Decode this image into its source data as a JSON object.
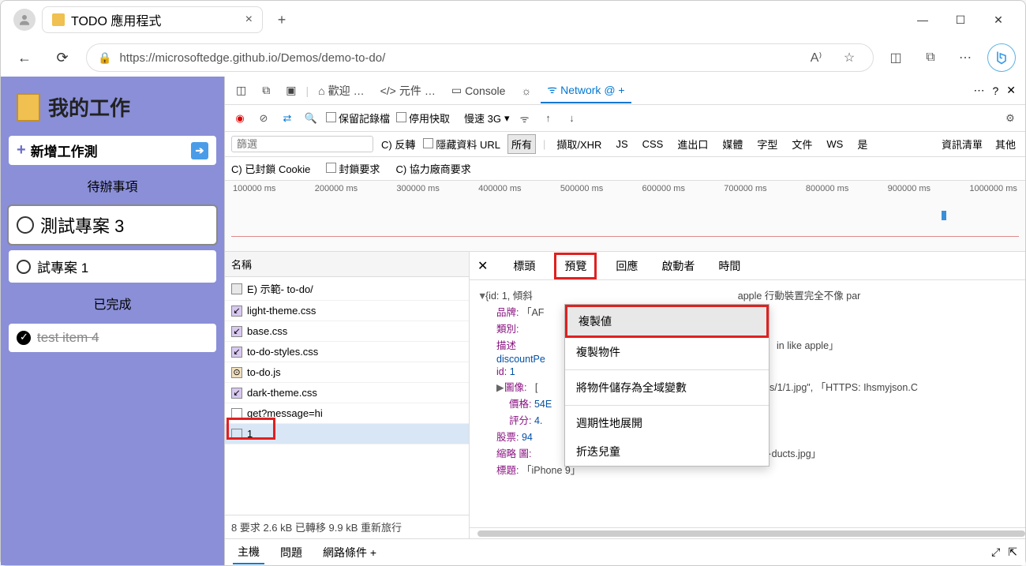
{
  "browser": {
    "tab_title": "TODO 應用程式",
    "url": "https://microsoftedge.github.io/Demos/demo-to-do/"
  },
  "app": {
    "title": "我的工作",
    "add_label": "新增工作測",
    "pending_label": "待辦事項",
    "tasks": [
      {
        "label": "測試專案 3",
        "selected": true
      },
      {
        "label": "試專案 1",
        "selected": false
      }
    ],
    "done_label": "已完成",
    "done_tasks": [
      {
        "label": "test item 4"
      }
    ]
  },
  "devtools": {
    "tabs": {
      "welcome": "歡迎",
      "elements": "元件",
      "console": "Console",
      "network": "Network @ +"
    },
    "toolbar": {
      "preserve_log": "保留記錄檔",
      "disable_cache": "停用快取",
      "throttle": "慢速 3G"
    },
    "filter": {
      "placeholder": "篩選",
      "invert": "C) 反轉",
      "hide_data": "隱藏資料 URL",
      "all": "所有",
      "xhr": "擷取/XHR",
      "js": "JS",
      "css": "CSS",
      "import": "進出口",
      "media": "媒體",
      "font": "字型",
      "doc": "文件",
      "ws": "WS",
      "wasm": "是",
      "manifest": "資訊清單",
      "other": "其他"
    },
    "filter2": {
      "blocked_cookies": "C) 已封鎖 Cookie",
      "blocked_requests": "封鎖要求",
      "third_party": "C) 協力廠商要求"
    },
    "timeline_ticks": [
      "100000 ms",
      "200000 ms",
      "300000 ms",
      "400000 ms",
      "500000 ms",
      "600000 ms",
      "700000 ms",
      "800000 ms",
      "900000 ms",
      "1000000 ms"
    ],
    "reqlist": {
      "header": "名稱",
      "rows": [
        {
          "label": "E) 示範- to-do/",
          "type": "doc"
        },
        {
          "label": "light-theme.css",
          "type": "css"
        },
        {
          "label": "base.css",
          "type": "css"
        },
        {
          "label": "to-do-styles.css",
          "type": "css"
        },
        {
          "label": "to-do.js",
          "type": "js"
        },
        {
          "label": "dark-theme.css",
          "type": "css"
        },
        {
          "label": "get?message=hi",
          "type": "xhr"
        },
        {
          "label": "1",
          "type": "xhr",
          "selected": true
        }
      ],
      "status": "8 要求 2.6 kB 已轉移 9.9 kB 重新旅行"
    },
    "detail": {
      "tabs": {
        "headers": "標頭",
        "preview": "預覽",
        "response": "回應",
        "initiator": "啟動者",
        "timing": "時間"
      },
      "preview": {
        "line1_a": "{id: 1, 傾斜",
        "line1_b": "apple 行動裝置完全不像 par",
        "brand_k": "品牌:",
        "brand_v": "「AF",
        "category_k": "類別:",
        "desc_k": "描述",
        "desc_v": "in like apple」",
        "discount_k": "discountPe",
        "id_k": "id:",
        "id_v": "1",
        "images_k": "圖像:",
        "images_v1": "[",
        "images_v2": "ducts/1/1.jpg\", 「HTTPS: Ihsmyjson.C",
        "price_k": "價格:",
        "price_v": "54E",
        "rating_k": "評分:",
        "rating_v": "4.",
        "stock_k": "股票:",
        "stock_v": "94",
        "thumb_k": "縮略 圖:",
        "thumb_v": "·ducts.jpg」",
        "title_k": "標題:",
        "title_v": "「iPhone 9」"
      },
      "context_menu": {
        "copy_value": "複製値",
        "copy_object": "複製物件",
        "store_global": "將物件儲存為全域變數",
        "expand_recursive": "週期性地展開",
        "collapse_children": "折迭兒童"
      }
    },
    "drawer": {
      "console": "主機",
      "issues": "問題",
      "network_conditions": "網路條件 +"
    }
  }
}
